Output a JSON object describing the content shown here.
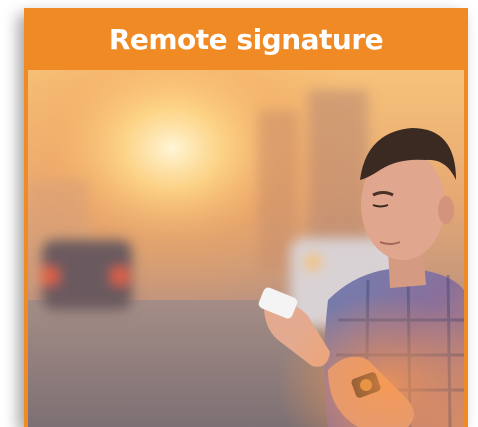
{
  "card": {
    "title": "Remote signature",
    "accent_color": "#f08a24"
  },
  "photo": {
    "subject": "man looking at smartphone at sunset on city street"
  }
}
